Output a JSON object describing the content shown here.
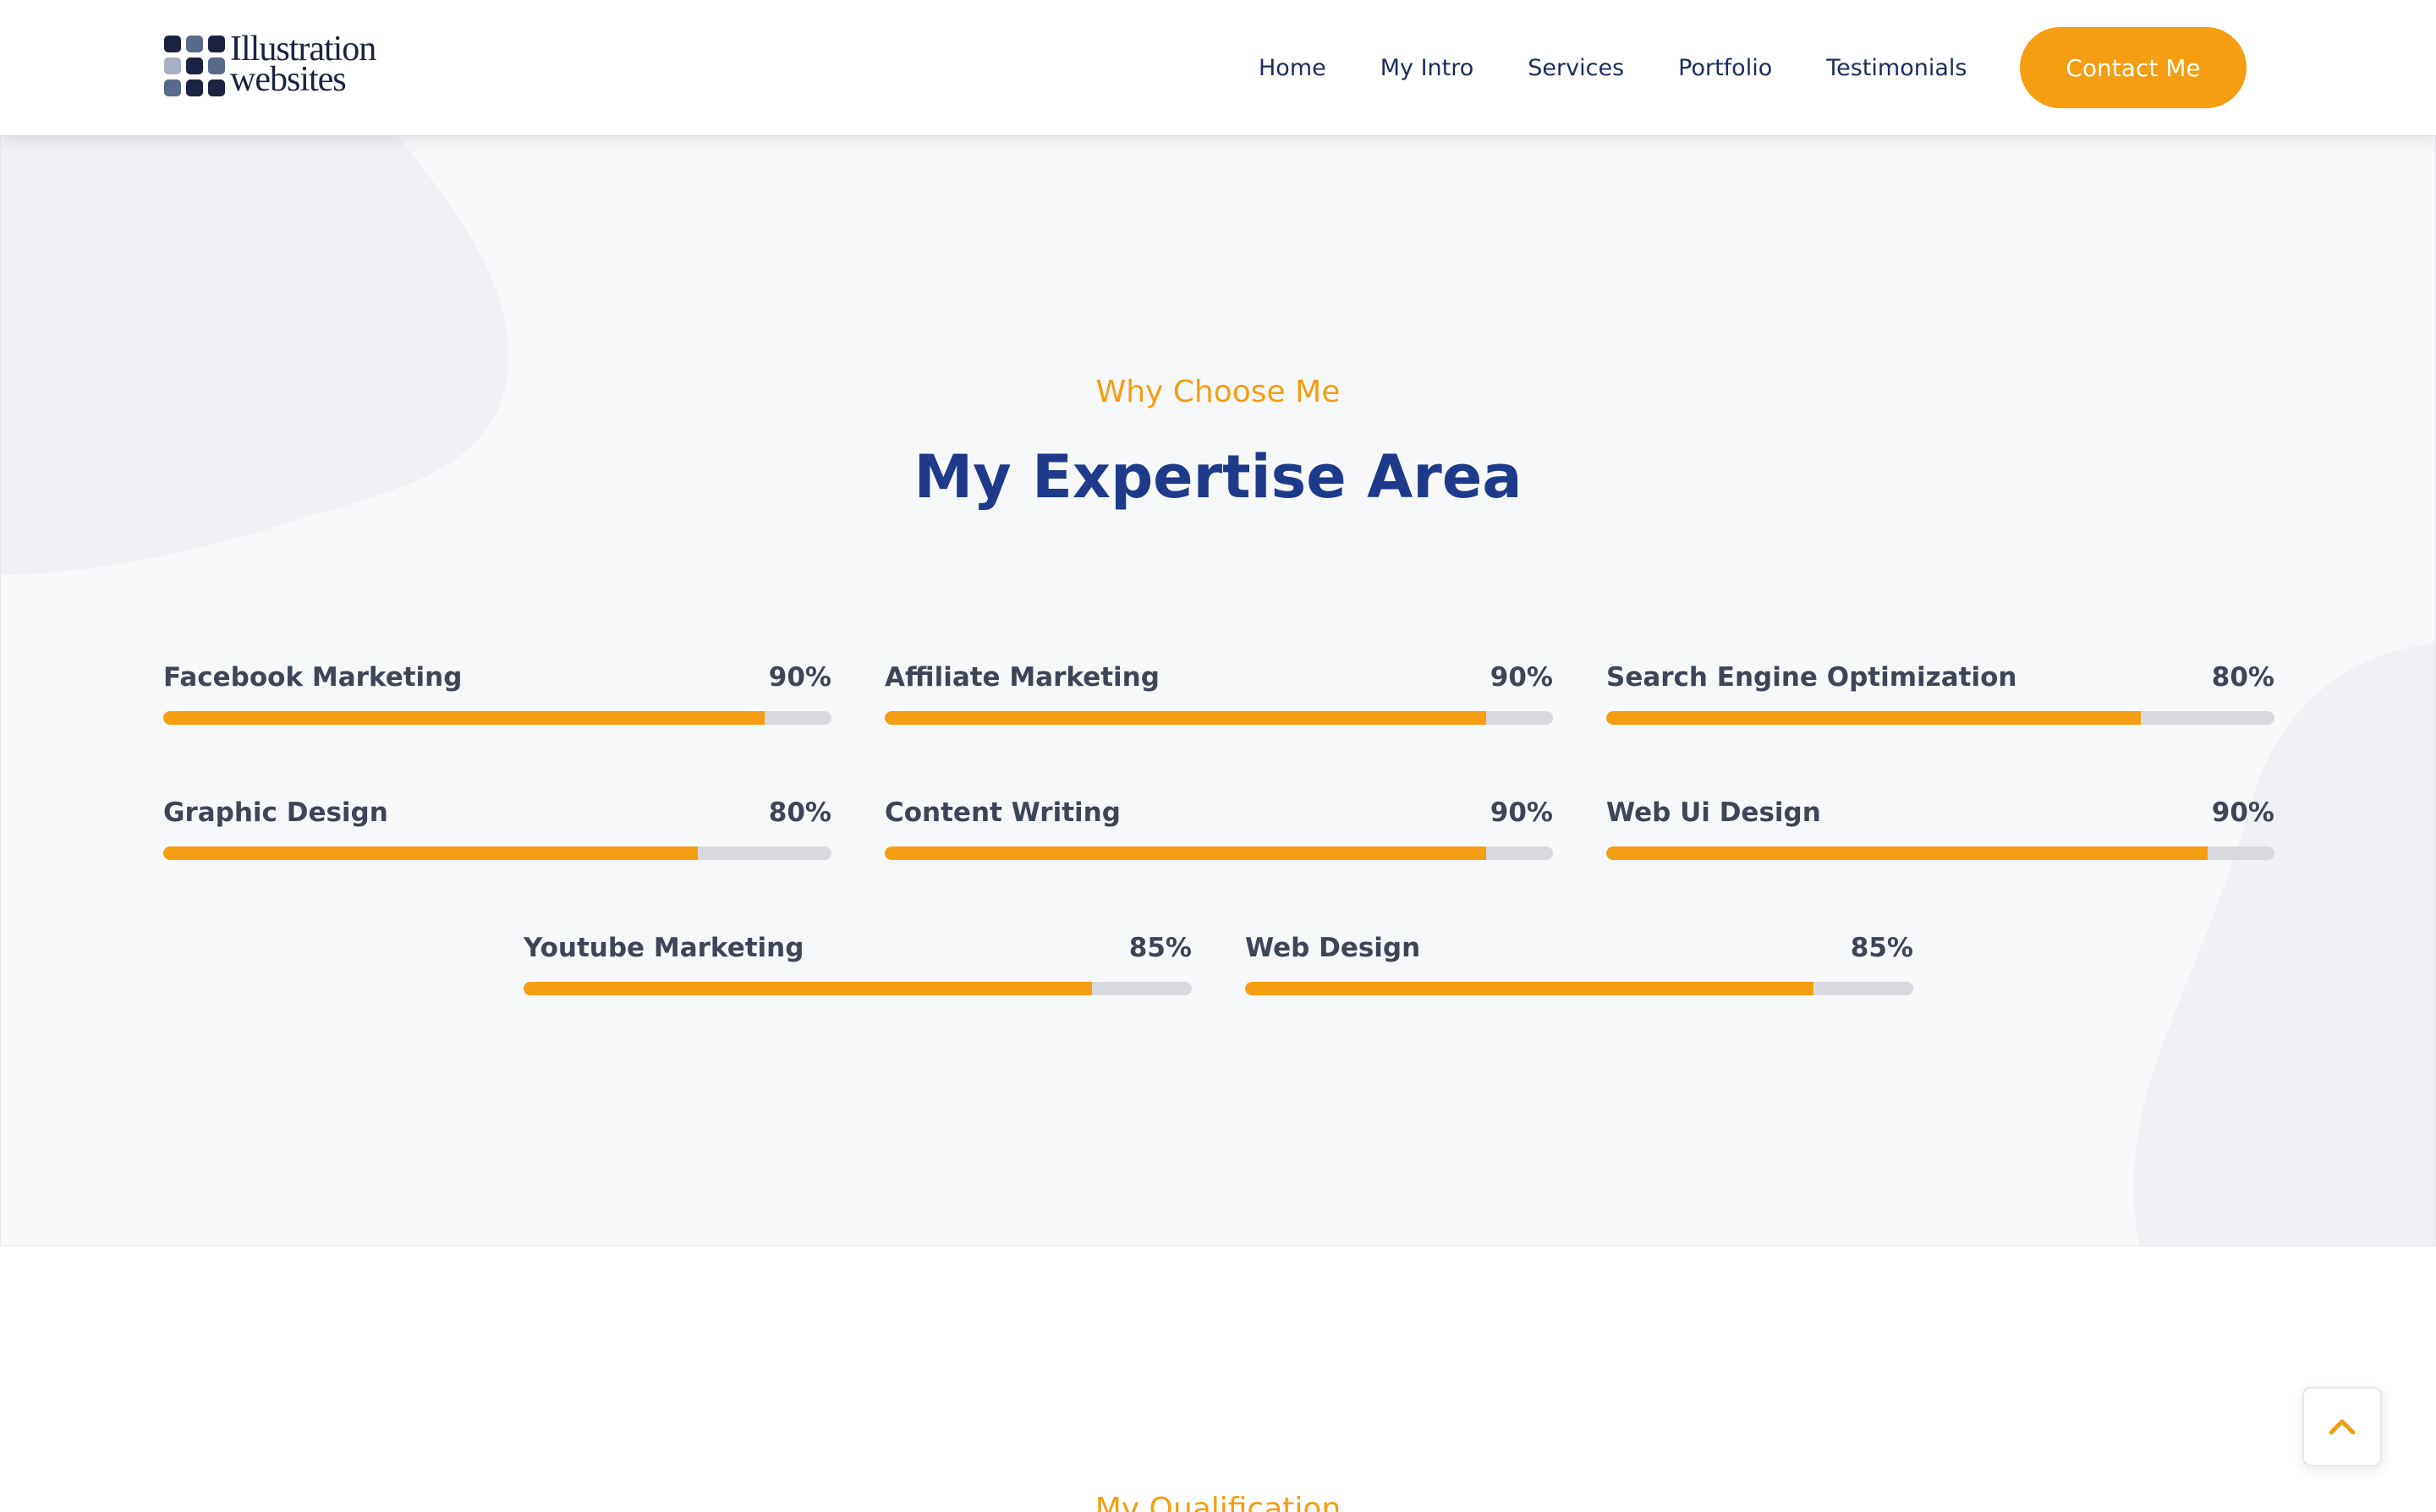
{
  "brand": {
    "logo_line1": "Illustration",
    "logo_line2": "websites",
    "logo_colors": [
      "#1b2340",
      "#5a6a8c",
      "#a7b0c3"
    ]
  },
  "nav": {
    "items": [
      {
        "label": "Home"
      },
      {
        "label": "My Intro"
      },
      {
        "label": "Services"
      },
      {
        "label": "Portfolio"
      },
      {
        "label": "Testimonials"
      }
    ],
    "cta_label": "Contact Me"
  },
  "expertise": {
    "kicker": "Why Choose Me",
    "title": "My Expertise Area",
    "skills": [
      {
        "name": "Facebook Marketing",
        "percent_label": "90%",
        "value": 90
      },
      {
        "name": "Affiliate Marketing",
        "percent_label": "90%",
        "value": 90
      },
      {
        "name": "Search Engine Optimization",
        "percent_label": "80%",
        "value": 80
      },
      {
        "name": "Graphic Design",
        "percent_label": "80%",
        "value": 80
      },
      {
        "name": "Content Writing",
        "percent_label": "90%",
        "value": 90
      },
      {
        "name": "Web Ui Design",
        "percent_label": "90%",
        "value": 90
      },
      {
        "name": "Youtube Marketing",
        "percent_label": "85%",
        "value": 85
      },
      {
        "name": "Web Design",
        "percent_label": "85%",
        "value": 85
      }
    ]
  },
  "qualification": {
    "kicker": "My Qualification"
  },
  "scroll_top": {
    "icon": "chevron-up-icon"
  },
  "colors": {
    "accent": "#f59e12",
    "heading": "#1e3a8a",
    "nav_text": "#1e2b5f",
    "track": "#d7d9de",
    "section_bg": "#f7f8fa"
  }
}
